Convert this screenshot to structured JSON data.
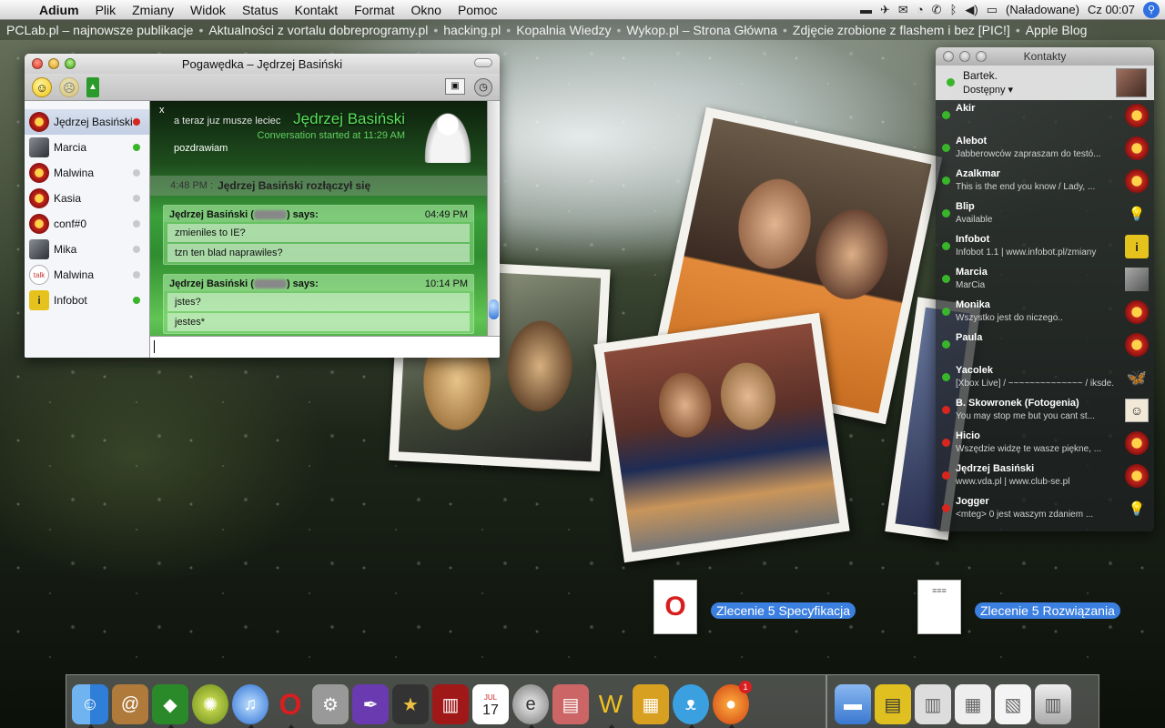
{
  "menubar": {
    "app": "Adium",
    "items": [
      "Plik",
      "Zmiany",
      "Widok",
      "Status",
      "Kontakt",
      "Format",
      "Okno",
      "Pomoc"
    ],
    "battery": "(Naładowane)",
    "clock": "Cz 00:07"
  },
  "bookmarks": [
    "PCLab.pl – najnowsze publikacje",
    "Aktualności z vortalu dobreprogramy.pl",
    "hacking.pl",
    "Kopalnia Wiedzy",
    "Wykop.pl – Strona Główna",
    "Zdjęcie zrobione z flashem i bez [PIC!]",
    "Apple Blog"
  ],
  "chat": {
    "title": "Pogawędka – Jędrzej Basiński",
    "contacts": [
      {
        "name": "Jędrzej Basiński",
        "status": "red",
        "avatar": "sun-icon"
      },
      {
        "name": "Marcia",
        "status": "green",
        "avatar": "photo-icon"
      },
      {
        "name": "Malwina",
        "status": "grey",
        "avatar": "sun-icon"
      },
      {
        "name": "Kasia",
        "status": "grey",
        "avatar": "sun-icon"
      },
      {
        "name": "conf#0",
        "status": "grey",
        "avatar": "sun-icon"
      },
      {
        "name": "Mika",
        "status": "grey",
        "avatar": "photo-icon"
      },
      {
        "name": "Malwina",
        "status": "grey",
        "avatar": "talk-icon"
      },
      {
        "name": "Infobot",
        "status": "green",
        "avatar": "info-icon"
      }
    ],
    "header": {
      "close": "x",
      "name": "Jędrzej Basiński",
      "started": "Conversation started at 11:29 AM",
      "msg1": "a teraz juz musze leciec",
      "msg2": "pozdrawiam"
    },
    "status_line": {
      "time": "4:48 PM :",
      "text": "Jędrzej Basiński rozłączył się"
    },
    "messages": [
      {
        "from": "Jędrzej Basiński (",
        "says": ") says:",
        "time": "04:49 PM",
        "lines": [
          "zmieniles to IE?",
          "tzn ten blad naprawiles?"
        ]
      },
      {
        "from": "Jędrzej Basiński (",
        "says": ") says:",
        "time": "10:14 PM",
        "lines": [
          "jstes?",
          "jestes*"
        ]
      }
    ]
  },
  "contacts_window": {
    "title": "Kontakty",
    "me": {
      "name": "Bartek.",
      "status": "Dostępny"
    },
    "list": [
      {
        "name": "Akir",
        "sub": "",
        "dot": "green",
        "icon": "sun"
      },
      {
        "name": "Alebot",
        "sub": "Jabberowców zapraszam do testó...",
        "dot": "green",
        "icon": "sun"
      },
      {
        "name": "Azalkmar",
        "sub": "This is the end you know  / Lady, ...",
        "dot": "green",
        "icon": "sun"
      },
      {
        "name": "Blip",
        "sub": "Available",
        "dot": "green",
        "icon": "bulb"
      },
      {
        "name": "Infobot",
        "sub": "Infobot 1.1 | www.infobot.pl/zmiany",
        "dot": "green",
        "icon": "info"
      },
      {
        "name": "Marcia",
        "sub": "MarCia",
        "dot": "green",
        "icon": "ph"
      },
      {
        "name": "Monika",
        "sub": "Wszystko jest do niczego..",
        "dot": "green",
        "icon": "sun"
      },
      {
        "name": "Paula",
        "sub": "",
        "dot": "green",
        "icon": "sun"
      },
      {
        "name": "Yacolek",
        "sub": "[Xbox Live] / ~~~~~~~~~~~~~~ / iksde.",
        "dot": "green",
        "icon": "butt"
      },
      {
        "name": "B. Skowronek (Fotogenia)",
        "sub": "You may stop me but you cant st...",
        "dot": "red",
        "icon": "face"
      },
      {
        "name": "Hicio",
        "sub": "Wszędzie widzę te wasze piękne, ...",
        "dot": "red",
        "icon": "sun"
      },
      {
        "name": "Jędrzej Basiński",
        "sub": "www.vda.pl | www.club-se.pl",
        "dot": "red",
        "icon": "sun"
      },
      {
        "name": "Jogger",
        "sub": "<mteg> 0 jest waszym zdaniem ...",
        "dot": "red",
        "icon": "bulb"
      }
    ]
  },
  "desktop": {
    "icon1_label": "Zlecenie 5 Specyfikacja",
    "icon2_label": "Zlecenie 5 Rozwiązania"
  },
  "dock": {
    "calendar_day": "17",
    "calendar_month": "JUL",
    "badge": "1"
  },
  "colors": {
    "status_green": "#39b52a",
    "status_red": "#d8261e",
    "status_grey": "#c9c9c9",
    "accent": "#3b7fe0"
  }
}
